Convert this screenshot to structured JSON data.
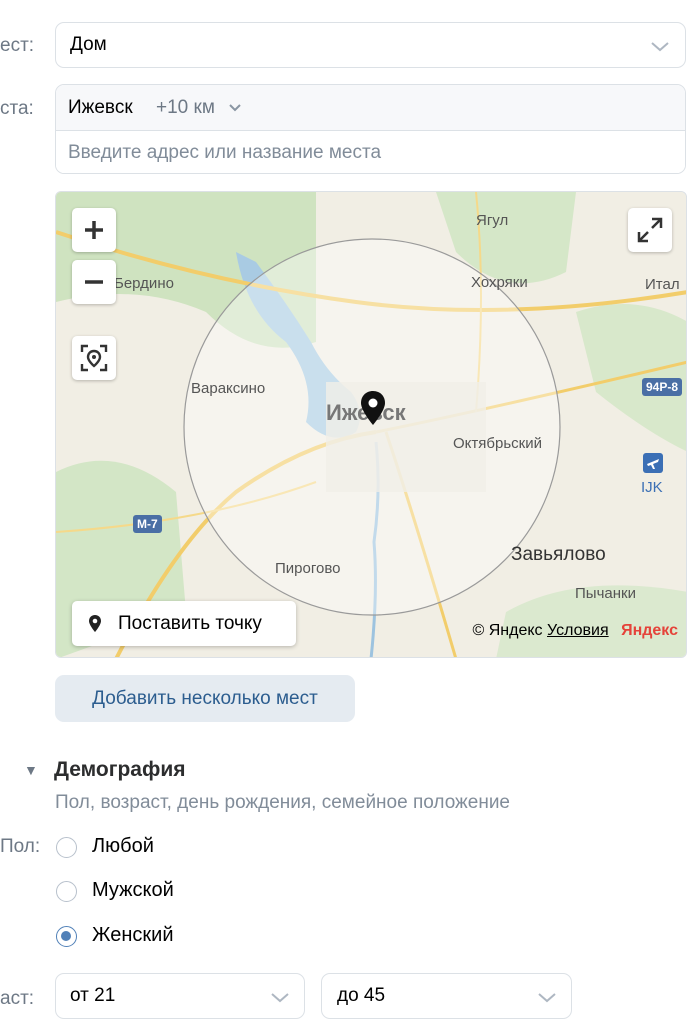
{
  "place_type": {
    "label": "ест:",
    "value": "Дом"
  },
  "location": {
    "label": "ста:",
    "city": "Ижевск",
    "radius": "+10 км",
    "address_placeholder": "Введите адрес или название места"
  },
  "map": {
    "city_label": "Ижевск",
    "places": [
      "Ягул",
      "Хохряки",
      "Итал",
      "Бердино",
      "Вараксино",
      "Октябрьский",
      "Завьялово",
      "Пирогово",
      "Пычанки",
      "IJK"
    ],
    "roads": [
      "М-7",
      "94Р-8"
    ],
    "set_point_label": "Поставить точку",
    "copyright": "© Яндекс",
    "terms_link": "Условия",
    "brand": "Яндекс"
  },
  "add_places_label": "Добавить несколько мест",
  "demography": {
    "title": "Демография",
    "subtitle": "Пол, возраст, день рождения, семейное положение",
    "gender_label": "Пол:",
    "gender_options": [
      {
        "label": "Любой",
        "selected": false
      },
      {
        "label": "Мужской",
        "selected": false
      },
      {
        "label": "Женский",
        "selected": true
      }
    ],
    "age_label": "аст:",
    "age_from": "от 21",
    "age_to": "до 45"
  },
  "colors": {
    "accent": "#5181b8",
    "button_bg": "#e5ebf1",
    "button_text": "#2c5d8f"
  }
}
